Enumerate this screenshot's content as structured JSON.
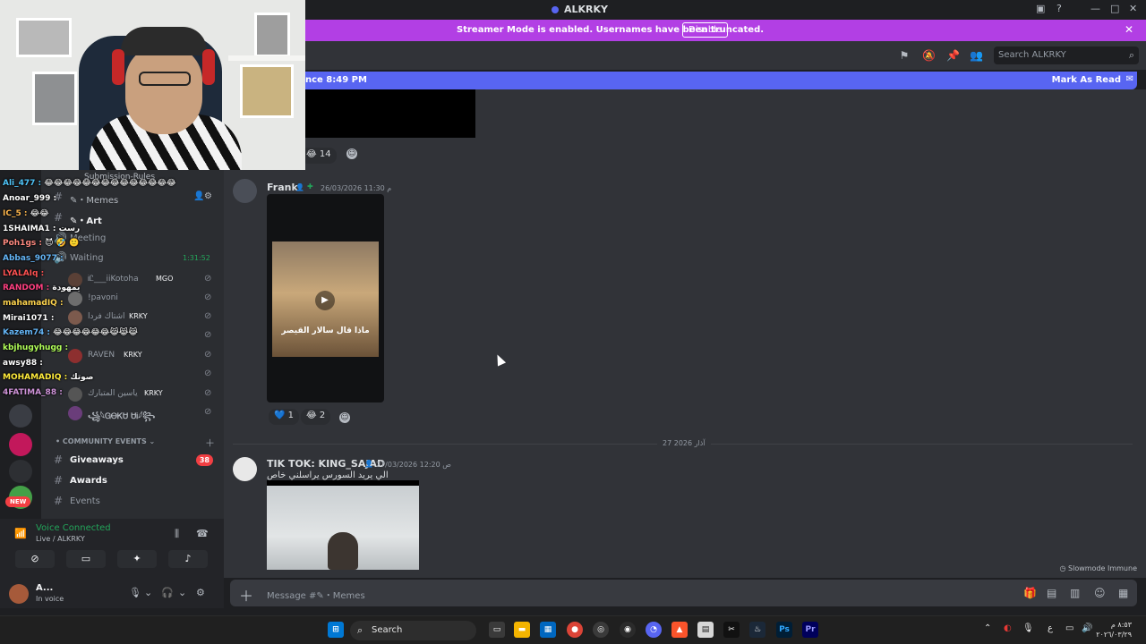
{
  "window": {
    "title": "ALKRKY"
  },
  "banner": {
    "message": "Streamer Mode is enabled. Usernames have been truncated.",
    "disable_label": "Disable"
  },
  "header": {
    "search_placeholder": "Search ALKRKY"
  },
  "new_messages": {
    "since_text": "nce 8:49 PM",
    "mark_read_label": "Mark As Read"
  },
  "chat": {
    "top_reaction_count": "14",
    "messages": [
      {
        "author": "Frank",
        "timestamp": "26/03/2026 11:30 م",
        "video_caption": "ماذا قال سالار القيصر",
        "reactions": [
          {
            "emoji": "💙",
            "count": "1"
          },
          {
            "emoji": "😂",
            "count": "2"
          }
        ]
      },
      {
        "author": "TIK TOK: KING_SAJAD",
        "timestamp": "27/03/2026 12:20 ص",
        "text": "الي يريد السورس يراسلني خاص"
      }
    ],
    "date_divider": "27 آذار 2026",
    "slowmode": "Slowmode Immune"
  },
  "composer": {
    "placeholder": "Message #✎・Memes"
  },
  "sidebar": {
    "channels": [
      {
        "label": "Submission-Rules"
      },
      {
        "label": "✎・Memes"
      },
      {
        "label": "✎・Art"
      },
      {
        "label": "Meeting"
      },
      {
        "label": "Waiting",
        "time": "1:31:52"
      }
    ],
    "voice_users": [
      "ᎥᏝ___iiKotoha",
      "!pavoni",
      "اشتاك فردا",
      "RAVEN",
      "ياسين المتبارك",
      "꧁𓆩ᏀᎾᏦᏌ ᏌᎥ𓆪꧂"
    ],
    "voice_tags": [
      "MGO",
      "KRKY",
      "KRKY",
      "KRKY"
    ],
    "category": "COMMUNITY EVENTS",
    "event_channels": [
      {
        "label": "Giveaways",
        "badge": "38"
      },
      {
        "label": "Awards"
      },
      {
        "label": "Events"
      }
    ],
    "new_badge": "NEW"
  },
  "voice_panel": {
    "status": "Voice Connected",
    "channel": "Live / ALKRKY",
    "user_name": "A...",
    "user_status": "In voice"
  },
  "stream_chat": [
    {
      "user": "Ali_477 :",
      "text": "😂😂😂😂😂😂😂😂😂😂😂😂😂😂",
      "color": "#4fc3f7"
    },
    {
      "user": "Anoar_999 :",
      "text": "",
      "color": "#ffffff"
    },
    {
      "user": "IC_5 :",
      "text": "😂😂",
      "color": "#ffb74d"
    },
    {
      "user": "1SHAIMA1 :",
      "text": "رست",
      "color": "#ffffff"
    },
    {
      "user": "Poh1gs :",
      "text": "😈 🤣 🙂",
      "color": "#ff8a80"
    },
    {
      "user": "Abbas_9077 :",
      "text": "",
      "color": "#64b5f6"
    },
    {
      "user": "LYALAIq :",
      "text": "",
      "color": "#ff5252"
    },
    {
      "user": "RANDOM :",
      "text": "يمهودة",
      "color": "#ff4081"
    },
    {
      "user": "mahamadIQ :",
      "text": "",
      "color": "#ffd54f"
    },
    {
      "user": "Mirai1071 :",
      "text": "",
      "color": "#ffffff"
    },
    {
      "user": "Kazem74 :",
      "text": "😂😂😂😂😂😂😹😹😹",
      "color": "#64b5f6"
    },
    {
      "user": "kbjhugyhugg :",
      "text": "",
      "color": "#b2ff59"
    },
    {
      "user": "awsy88 :",
      "text": "",
      "color": "#ffffff"
    },
    {
      "user": "MOHAMADIQ :",
      "text": "صوتك",
      "color": "#ffeb3b"
    },
    {
      "user": "4FATIMA_88 :",
      "text": "",
      "color": "#ce93d8"
    }
  ],
  "taskbar": {
    "search_placeholder": "Search",
    "clock_time": "٨:٥٣ م",
    "clock_date": "٢٠٢٦/٠٣/٢٩"
  }
}
